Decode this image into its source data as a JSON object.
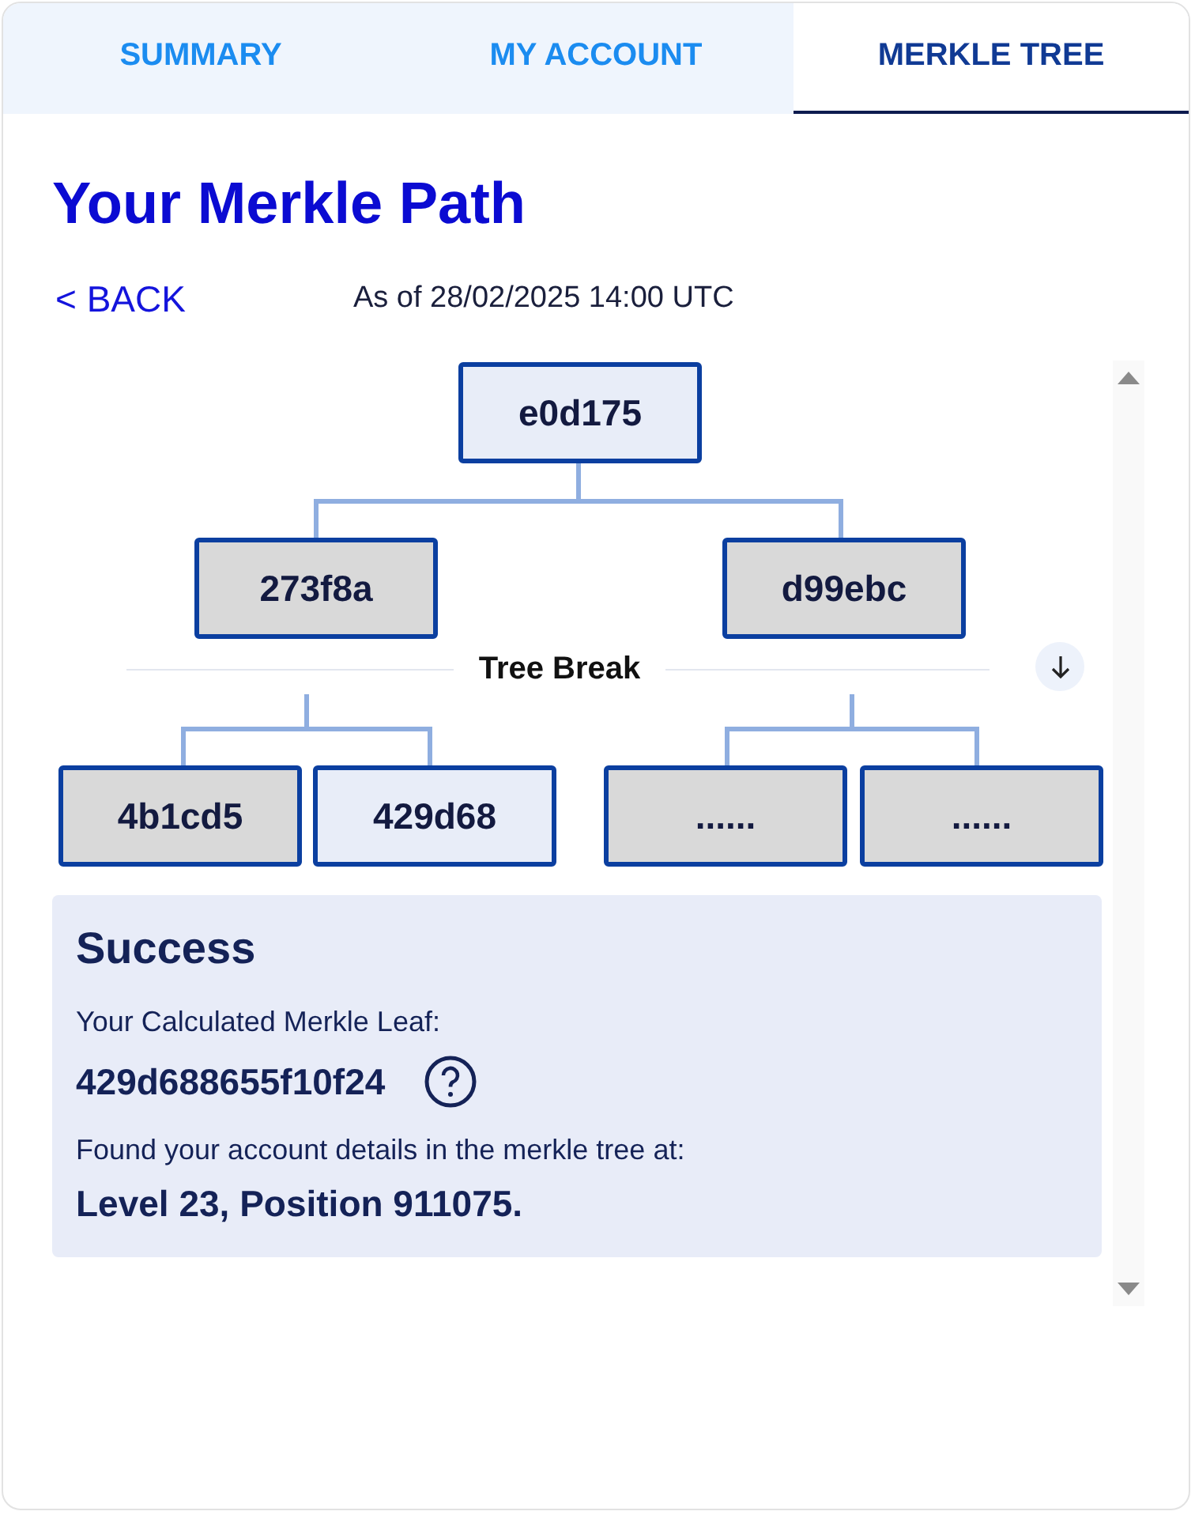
{
  "tabs": [
    {
      "label": "SUMMARY",
      "selected": false
    },
    {
      "label": "MY ACCOUNT",
      "selected": false
    },
    {
      "label": "MERKLE TREE",
      "selected": true
    }
  ],
  "page": {
    "title": "Your Merkle Path",
    "back": "< BACK",
    "as_of": "As of 28/02/2025 14:00 UTC"
  },
  "tree": {
    "root": {
      "label": "e0d175",
      "highlighted": true
    },
    "level_2": [
      {
        "label": "273f8a",
        "highlighted": false
      },
      {
        "label": "d99ebc",
        "highlighted": false
      }
    ],
    "break_label": "Tree Break",
    "level_3": [
      {
        "label": "4b1cd5",
        "highlighted": false
      },
      {
        "label": "429d68",
        "highlighted": true
      },
      {
        "label": "......",
        "highlighted": false
      },
      {
        "label": "......",
        "highlighted": false
      }
    ]
  },
  "result": {
    "title": "Success",
    "leaf_label": "Your Calculated Merkle Leaf:",
    "leaf_value": "429d688655f10f24",
    "found_label": "Found your account details in the merkle tree at:",
    "found_value": "Level 23, Position 911075."
  }
}
